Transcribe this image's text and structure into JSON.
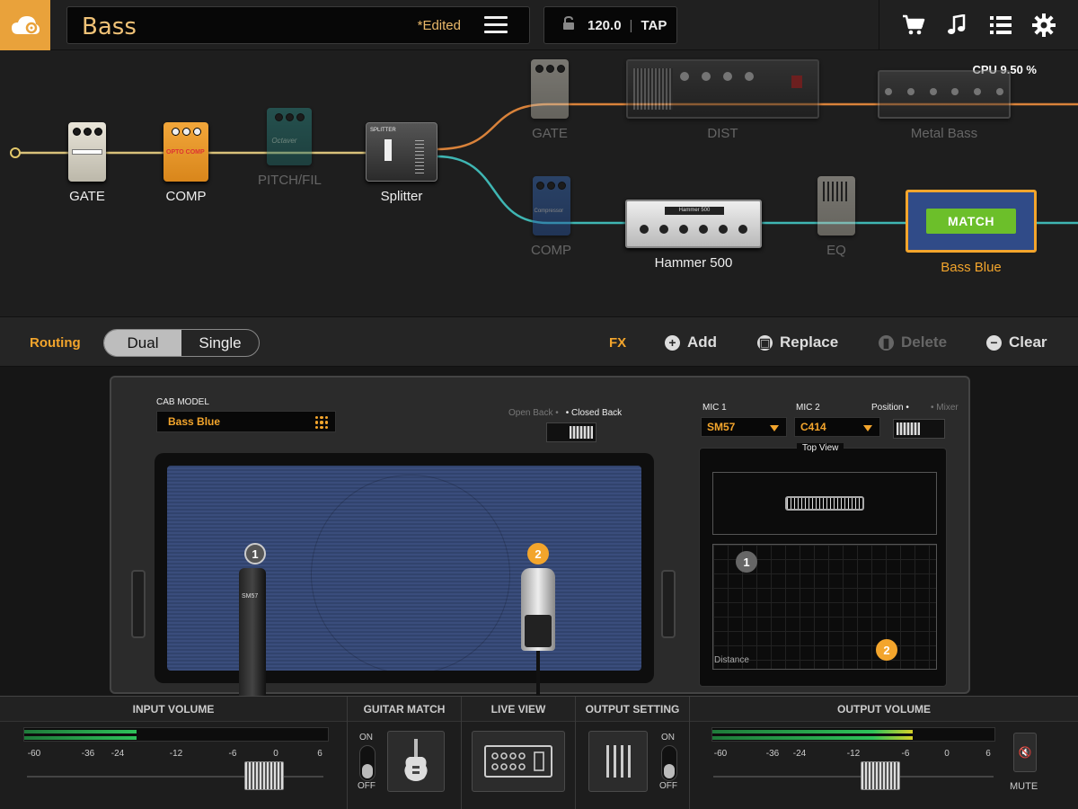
{
  "topbar": {
    "preset_name": "Bass",
    "edited_label": "*Edited",
    "tempo": "120.0",
    "tap_label": "TAP",
    "icons": [
      "cloud-icon",
      "lock-icon",
      "menu-icon",
      "cart-icon",
      "music-note-icon",
      "list-icon",
      "gear-icon"
    ]
  },
  "chain": {
    "cpu": "CPU 9.50 %",
    "input": [
      {
        "label": "GATE"
      },
      {
        "label": "COMP"
      },
      {
        "label": "PITCH/FIL"
      },
      {
        "label": "Splitter"
      }
    ],
    "path_a": [
      {
        "label": "GATE"
      },
      {
        "label": "DIST"
      },
      {
        "label": "Metal Bass"
      }
    ],
    "path_b": [
      {
        "label": "COMP"
      },
      {
        "label": "Hammer 500"
      },
      {
        "label": "EQ"
      },
      {
        "label": "Bass Blue"
      }
    ],
    "match_label": "MATCH",
    "amp_plate": "Hammer 500",
    "pedal_text": {
      "opto_comp": "OPTO COMP",
      "octaver": "Octaver",
      "splitter": "SPLITTER",
      "compressor": "Compressor"
    },
    "colors": {
      "path_a": "#d9823a",
      "path_b": "#3fb6b3",
      "accent": "#f3a52c"
    }
  },
  "fxbar": {
    "routing_label": "Routing",
    "routing_options": [
      "Dual",
      "Single"
    ],
    "routing_selected": "Dual",
    "fx_label": "FX",
    "add_label": "Add",
    "replace_label": "Replace",
    "delete_label": "Delete",
    "clear_label": "Clear"
  },
  "cab": {
    "model_title": "CAB MODEL",
    "model_value": "Bass Blue",
    "open_back": "Open Back •",
    "closed_back": "• Closed Back",
    "mic1_badge": "1",
    "mic2_badge": "2",
    "mic1_name_on_body": "SM57"
  },
  "mics": {
    "mic1_title": "MIC 1",
    "mic1_value": "SM57",
    "mic2_title": "MIC 2",
    "mic2_value": "C414",
    "position_label": "Position •",
    "mixer_label": "• Mixer",
    "top_view_label": "Top View",
    "distance_label": "Distance"
  },
  "bottom": {
    "input_volume": {
      "title": "INPUT VOLUME",
      "scale": [
        "-60",
        "-36",
        "-24",
        "-12",
        "-6",
        "0",
        "6"
      ],
      "level": 0.37
    },
    "guitar_match": {
      "title": "GUITAR MATCH",
      "on": "ON",
      "off": "OFF",
      "state": "off"
    },
    "live_view": {
      "title": "LIVE VIEW"
    },
    "output_setting": {
      "title": "OUTPUT SETTING",
      "on": "ON",
      "off": "OFF",
      "state": "off"
    },
    "output_volume": {
      "title": "OUTPUT VOLUME",
      "scale": [
        "-60",
        "-36",
        "-24",
        "-12",
        "-6",
        "0",
        "6"
      ],
      "level": 0.71
    },
    "mute_label": "MUTE"
  }
}
